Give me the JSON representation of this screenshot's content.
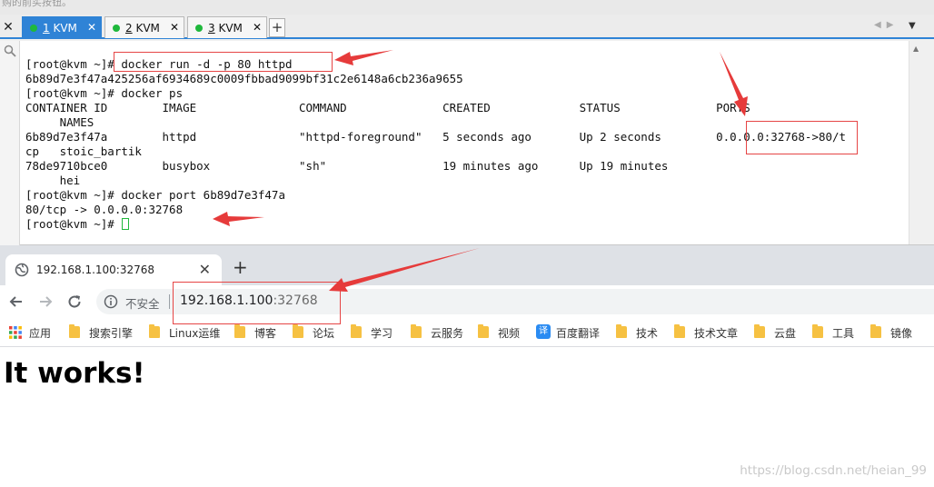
{
  "top_strip_text": "购的前买按钮。",
  "terminal": {
    "tabs": [
      {
        "num": "1",
        "name": " KVM",
        "active": true
      },
      {
        "num": "2",
        "name": " KVM",
        "active": false
      },
      {
        "num": "3",
        "name": " KVM",
        "active": false
      }
    ],
    "lines": [
      "[root@kvm ~]# docker run -d -p 80 httpd",
      "6b89d7e3f47a425256af6934689c0009fbbad9099bf31c2e6148a6cb236a9655",
      "[root@kvm ~]# docker ps",
      "CONTAINER ID        IMAGE               COMMAND              CREATED             STATUS              PORTS",
      "     NAMES",
      "6b89d7e3f47a        httpd               \"httpd-foreground\"   5 seconds ago       Up 2 seconds        0.0.0.0:32768->80/t",
      "cp   stoic_bartik",
      "78de9710bce0        busybox             \"sh\"                 19 minutes ago      Up 19 minutes",
      "     hei",
      "[root@kvm ~]# docker port 6b89d7e3f47a",
      "80/tcp -> 0.0.0.0:32768"
    ],
    "prompt": "[root@kvm ~]# "
  },
  "browser": {
    "tab_title": "192.168.1.100:32768",
    "insecure_label": "不安全",
    "url_host": "192.168.1.100",
    "url_port": ":32768",
    "bookmarks": [
      {
        "label": "应用",
        "icon": "apps-grid-icon"
      },
      {
        "label": "搜索引擎",
        "icon": "folder-icon"
      },
      {
        "label": "Linux运维",
        "icon": "folder-icon"
      },
      {
        "label": "博客",
        "icon": "folder-icon"
      },
      {
        "label": "论坛",
        "icon": "folder-icon"
      },
      {
        "label": "学习",
        "icon": "folder-icon"
      },
      {
        "label": "云服务",
        "icon": "folder-icon"
      },
      {
        "label": "视频",
        "icon": "folder-icon"
      },
      {
        "label": "百度翻译",
        "icon": "translate-icon"
      },
      {
        "label": "技术",
        "icon": "folder-icon"
      },
      {
        "label": "技术文章",
        "icon": "folder-icon"
      },
      {
        "label": "云盘",
        "icon": "folder-icon"
      },
      {
        "label": "工具",
        "icon": "folder-icon"
      },
      {
        "label": "镜像",
        "icon": "folder-icon"
      }
    ],
    "fanyi_glyph": "译",
    "page_heading": "It works!"
  },
  "watermark": "https://blog.csdn.net/heian_99",
  "colors": {
    "terminal_tab_active": "#2f83d6",
    "session_dot": "#1fb83c",
    "annotation_red": "#e64545",
    "browser_tabstrip": "#dee1e6"
  }
}
